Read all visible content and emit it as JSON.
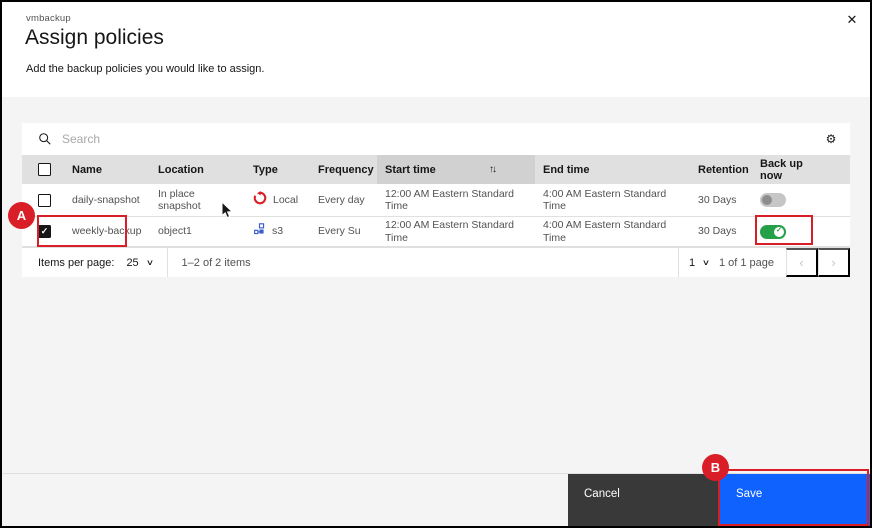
{
  "modal": {
    "eyebrow": "vmbackup",
    "title": "Assign policies",
    "subtitle": "Add the backup policies you would like to assign.",
    "close_glyph": "✕"
  },
  "toolbar": {
    "search_placeholder": "Search",
    "settings_glyph": "⚙"
  },
  "table": {
    "columns": {
      "name": "Name",
      "location": "Location",
      "type": "Type",
      "frequency": "Frequency",
      "start_time": "Start time",
      "end_time": "End time",
      "retention": "Retention",
      "backup_now": "Back up now"
    },
    "sorted_column": "Start time",
    "sort_glyph": "↑↓",
    "rows": [
      {
        "checked": false,
        "name": "daily-snapshot",
        "location": "In place snapshot",
        "type_icon": "restore-icon",
        "type": "Local",
        "frequency": "Every day",
        "start_time": "12:00 AM Eastern Standard Time",
        "end_time": "4:00 AM Eastern Standard Time",
        "retention": "30 Days",
        "backup_now_on": false
      },
      {
        "checked": true,
        "check_glyph": "✓",
        "name": "weekly-backup",
        "location": "object1",
        "type_icon": "object-storage-icon",
        "type": "s3",
        "frequency": "Every Su",
        "start_time": "12:00 AM Eastern Standard Time",
        "end_time": "4:00 AM Eastern Standard Time",
        "retention": "30 Days",
        "backup_now_on": true,
        "toggle_check_glyph": "✓"
      }
    ]
  },
  "pagination": {
    "items_per_page_label": "Items per page:",
    "items_per_page_value": "25",
    "range_text": "1–2 of 2 items",
    "page_value": "1",
    "page_text": "1 of 1 page",
    "prev_glyph": "‹",
    "next_glyph": "›"
  },
  "footer": {
    "cancel_label": "Cancel",
    "save_label": "Save"
  },
  "annotations": {
    "a_label": "A",
    "b_label": "B",
    "highlight_color": "#da1e28"
  },
  "colors": {
    "accent_blue": "#0f62fe",
    "secondary_dark": "#393939",
    "toggle_on_green": "#24a148",
    "local_icon_red": "#da1e28",
    "body_gray": "#f4f4f4",
    "header_gray": "#e0e0e0",
    "sorted_gray": "#d1d1d1"
  }
}
